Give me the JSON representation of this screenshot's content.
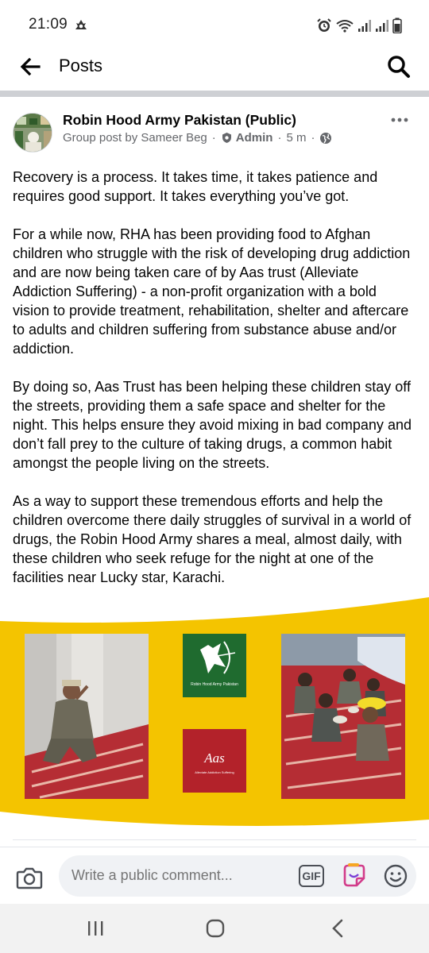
{
  "status_bar": {
    "time": "21:09"
  },
  "header": {
    "title": "Posts",
    "back_icon": "arrow-left-icon",
    "search_icon": "search-icon"
  },
  "post": {
    "author": "Robin Hood Army Pakistan (Public)",
    "meta": {
      "prefix": "Group post by Sameer Beg",
      "role": "Admin",
      "time": "5 m"
    },
    "paragraphs": [
      "Recovery is a process. It takes time, it takes patience and requires good support. It takes everything you’ve got.",
      "For a while now, RHA has been providing food to Afghan children who struggle with the risk of developing drug addiction and are now being taken care of by Aas trust (Alleviate Addiction Suffering) - a non-profit organization with a bold vision to provide treatment, rehabilitation, shelter and aftercare to adults and children suffering from substance abuse and/or addiction.",
      "By doing so, Aas Trust has been helping these children stay off the streets, providing them a safe space and shelter for the night. This helps ensure they avoid mixing in bad company and don’t fall prey to the culture of taking drugs, a common habit amongst the people living on the streets.",
      "As a way to support these tremendous efforts and help the children overcome there daily struggles of survival in a world of drugs, the Robin Hood Army shares a meal, almost daily, with these children who seek refuge for the night at one of the facilities near Lucky star, Karachi."
    ],
    "image": {
      "logo_rha_text": "Robin Hood Army Pakistan",
      "logo_aas_text": "Aas",
      "logo_aas_subtext": "Alleviate Addiction Suffering",
      "colors": {
        "background": "#f4c400",
        "rha_green": "#1f6b2f",
        "aas_red": "#b3222a"
      }
    }
  },
  "comment_bar": {
    "placeholder": "Write a public comment...",
    "gif_label": "GIF"
  }
}
